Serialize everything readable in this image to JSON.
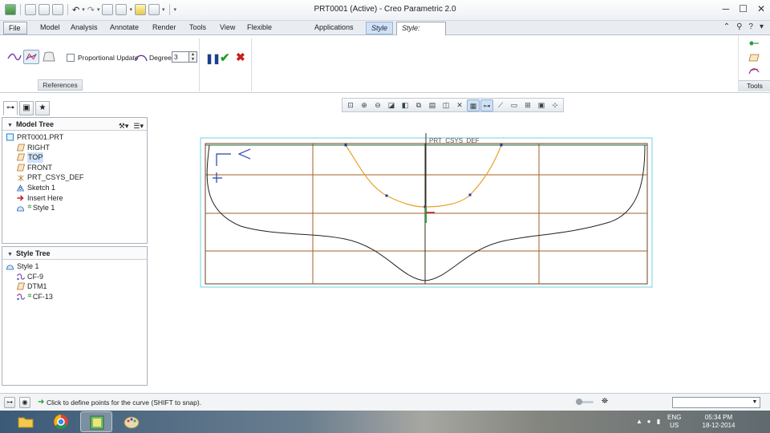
{
  "window": {
    "title": "PRT0001 (Active) - Creo Parametric 2.0"
  },
  "tabs": [
    {
      "label": "File ▾",
      "kind": "file"
    },
    {
      "label": "Model",
      "kind": "normal"
    },
    {
      "label": "Analysis",
      "kind": "normal"
    },
    {
      "label": "Annotate",
      "kind": "normal"
    },
    {
      "label": "Render",
      "kind": "normal"
    },
    {
      "label": "Tools",
      "kind": "normal"
    },
    {
      "label": "View",
      "kind": "normal"
    },
    {
      "label": "Flexible Modeling",
      "kind": "normal"
    },
    {
      "label": "Applications",
      "kind": "normal"
    },
    {
      "label": "Style",
      "kind": "style"
    },
    {
      "label": "Style: Curve",
      "kind": "active"
    }
  ],
  "ribbon": {
    "proportional_update_label": "Proportional Update",
    "proportional_update_checked": false,
    "degree_label": "Degree",
    "degree_value": "3",
    "references_label": "References",
    "tools_label": "Tools"
  },
  "model_tree": {
    "header": "Model Tree",
    "items": [
      {
        "label": "PRT0001.PRT",
        "icon": "part-icon",
        "indent": 0
      },
      {
        "label": "RIGHT",
        "icon": "datum-plane-icon",
        "indent": 1
      },
      {
        "label": "TOP",
        "icon": "datum-plane-icon",
        "indent": 1,
        "selected": true
      },
      {
        "label": "FRONT",
        "icon": "datum-plane-icon",
        "indent": 1
      },
      {
        "label": "PRT_CSYS_DEF",
        "icon": "coordinate-system-icon",
        "indent": 1
      },
      {
        "label": "Sketch 1",
        "icon": "sketch-icon",
        "indent": 1
      },
      {
        "label": "Insert Here",
        "icon": "insert-arrow-icon",
        "indent": 1
      },
      {
        "label": "Style 1",
        "icon": "style-feature-icon",
        "indent": 1
      }
    ]
  },
  "style_tree": {
    "header": "Style Tree",
    "items": [
      {
        "label": "Style 1",
        "icon": "style-feature-icon",
        "indent": 0
      },
      {
        "label": "CF-9",
        "icon": "free-curve-icon",
        "indent": 1
      },
      {
        "label": "DTM1",
        "icon": "datum-plane-icon",
        "indent": 1
      },
      {
        "label": "CF-13",
        "icon": "free-curve-icon",
        "indent": 1
      }
    ]
  },
  "canvas": {
    "csys_label": "PRT_CSYS_DEF"
  },
  "status": {
    "message": "Click to define points for the curve (SHIFT to snap).",
    "filter_value": ""
  },
  "taskbar": {
    "lang": "ENG",
    "region": "US",
    "time": "05:34 PM",
    "date": "18-12-2014"
  },
  "colors": {
    "curve_orange": "#e8a32a",
    "sketch_black": "#222222",
    "datum_brown": "#a0622a",
    "datum_cyan": "#6fd3e0",
    "point_blue": "#2233aa"
  }
}
